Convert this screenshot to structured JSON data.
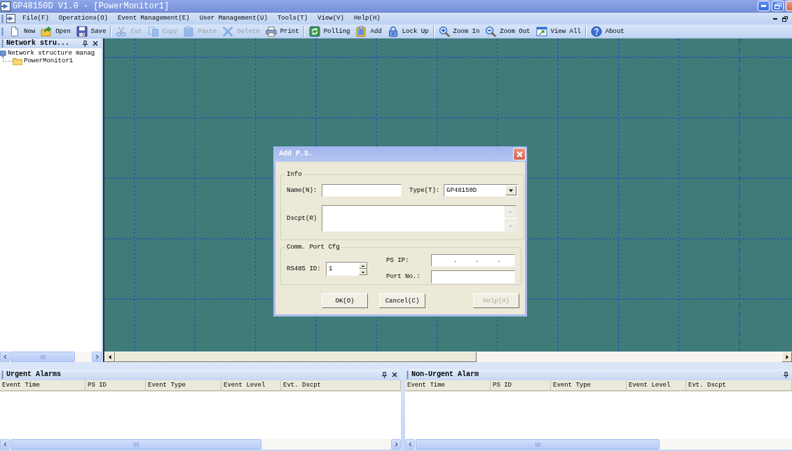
{
  "window": {
    "title": "GP48150D V1.0 - [PowerMonitor1]"
  },
  "menu_bar": {
    "items": [
      "File(F)",
      "Operations(O)",
      "Event Management(E)",
      "User Management(U)",
      "Tools(T)",
      "View(V)",
      "Help(H)"
    ]
  },
  "toolbar": {
    "groups": [
      {
        "buttons": [
          {
            "label": "New",
            "disabled": false
          },
          {
            "label": "Open",
            "disabled": false
          },
          {
            "label": "Save",
            "disabled": false
          }
        ]
      },
      {
        "buttons": [
          {
            "label": "Cut",
            "disabled": true
          },
          {
            "label": "Copy",
            "disabled": true
          },
          {
            "label": "Paste",
            "disabled": true
          },
          {
            "label": "Delete",
            "disabled": true
          },
          {
            "label": "Print",
            "disabled": false
          }
        ]
      },
      {
        "buttons": [
          {
            "label": "Polling",
            "disabled": false
          },
          {
            "label": "Add",
            "disabled": false
          },
          {
            "label": "Lock Up",
            "disabled": false
          }
        ]
      },
      {
        "buttons": [
          {
            "label": "Zoom In",
            "disabled": false
          },
          {
            "label": "Zoom Out",
            "disabled": false
          },
          {
            "label": "View All",
            "disabled": false
          }
        ]
      },
      {
        "buttons": [
          {
            "label": "About",
            "disabled": false
          }
        ]
      }
    ]
  },
  "tree_panel": {
    "title": "Network stru...",
    "tree": [
      {
        "label": "Network structure manag",
        "children": [
          {
            "label": "PowerMonitor1"
          }
        ]
      }
    ]
  },
  "dialog": {
    "title": "Add P.S.",
    "info_group": {
      "title": "Info",
      "name_label": "Name(N):",
      "type_label": "Type(T):",
      "type_value": "GP48150D",
      "description_label": "Dscpt(R)"
    },
    "comm_group": {
      "title": "Comm. Port Cfg",
      "rs485_label": "RS485 ID:",
      "rs485_value": "1",
      "ip_label": "PS IP:",
      "ip_separators": [
        ".",
        ".",
        "."
      ],
      "port_label": "Port No.:"
    },
    "buttons": [
      {
        "label": "OK(O)",
        "disabled": false
      },
      {
        "label": "Cancel(C)",
        "disabled": false
      },
      {
        "label": "Help(H)",
        "disabled": true
      }
    ]
  },
  "alarm_panels": [
    {
      "title": "Urgent Alarms",
      "columns": [
        "Event Time",
        "PS ID",
        "Event Type",
        "Event Level",
        "Evt. Dscpt"
      ]
    },
    {
      "title": "Non-Urgent Alarm",
      "columns": [
        "Event Time",
        "PS ID",
        "Event Type",
        "Event Level",
        "Evt. Dscpt"
      ]
    }
  ]
}
